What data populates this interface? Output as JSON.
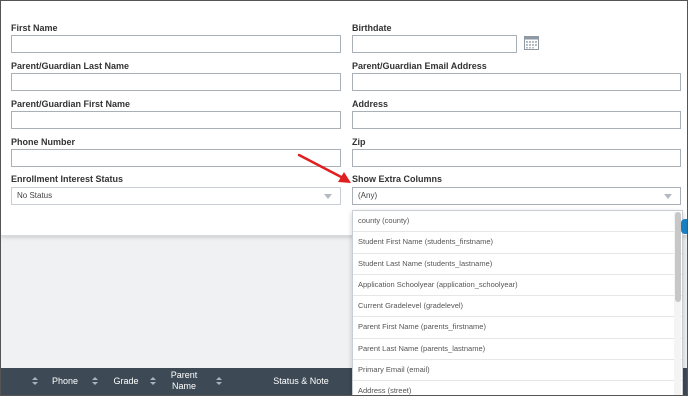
{
  "form": {
    "first_name": {
      "label": "First Name",
      "value": ""
    },
    "birthdate": {
      "label": "Birthdate",
      "value": ""
    },
    "guardian_last_name": {
      "label": "Parent/Guardian Last Name",
      "value": ""
    },
    "guardian_email": {
      "label": "Parent/Guardian Email Address",
      "value": ""
    },
    "guardian_first_name": {
      "label": "Parent/Guardian First Name",
      "value": ""
    },
    "address": {
      "label": "Address",
      "value": ""
    },
    "phone": {
      "label": "Phone Number",
      "value": ""
    },
    "zip": {
      "label": "Zip",
      "value": ""
    },
    "enrollment_status": {
      "label": "Enrollment Interest Status",
      "selected": "No Status"
    },
    "extra_columns": {
      "label": "Show Extra Columns",
      "selected": "(Any)"
    }
  },
  "dropdown": {
    "items": [
      "county (county)",
      "Student First Name (students_firstname)",
      "Student Last Name (students_lastname)",
      "Application Schoolyear (application_schoolyear)",
      "Current Gradelevel (gradelevel)",
      "Parent First Name (parents_firstname)",
      "Parent Last Name (parents_lastname)",
      "Primary Email (email)",
      "Address (street)"
    ]
  },
  "table": {
    "headers": [
      "Phone",
      "Grade",
      "Parent\nName",
      "Status & Note"
    ]
  },
  "icons": {
    "calendar": "calendar-icon",
    "sort": "sort-icon",
    "caret": "chevron-down-icon",
    "annotation": "red-arrow-icon"
  },
  "colors": {
    "table_header": "#3d4a56",
    "annotation_arrow": "#e02020",
    "accent_tab": "#1a7fc1"
  }
}
